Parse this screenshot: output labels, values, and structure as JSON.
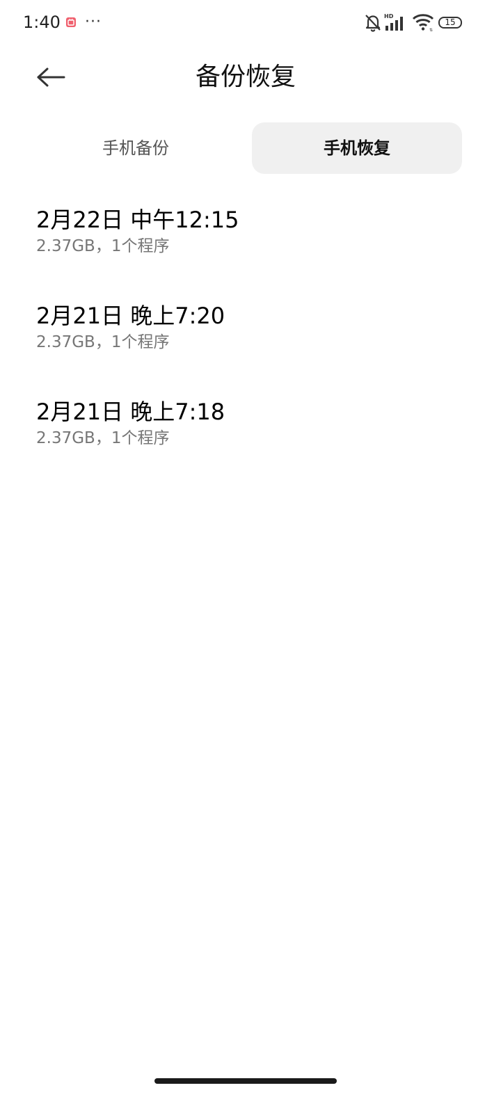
{
  "status_bar": {
    "time": "1:40",
    "more": "···",
    "battery_level": "15",
    "signal_label": "HD",
    "icons": [
      "notification-app-icon",
      "more-notifications-icon",
      "silent-bell-icon",
      "hd-signal-icon",
      "wifi-icon",
      "battery-icon"
    ],
    "app_icon_color": "#f0606e"
  },
  "header": {
    "title": "备份恢复",
    "back_icon": "arrow-left-icon"
  },
  "tabs": [
    {
      "label": "手机备份",
      "selected": false
    },
    {
      "label": "手机恢复",
      "selected": true
    }
  ],
  "backups": [
    {
      "title": "2月22日 中午12:15",
      "subtitle": "2.37GB，1个程序"
    },
    {
      "title": "2月21日 晚上7:20",
      "subtitle": "2.37GB，1个程序"
    },
    {
      "title": "2月21日 晚上7:18",
      "subtitle": "2.37GB，1个程序"
    }
  ],
  "colors": {
    "background": "#ffffff",
    "selected_tab_background": "#f0f0f0",
    "primary_text": "#000000",
    "secondary_text": "#767676"
  }
}
